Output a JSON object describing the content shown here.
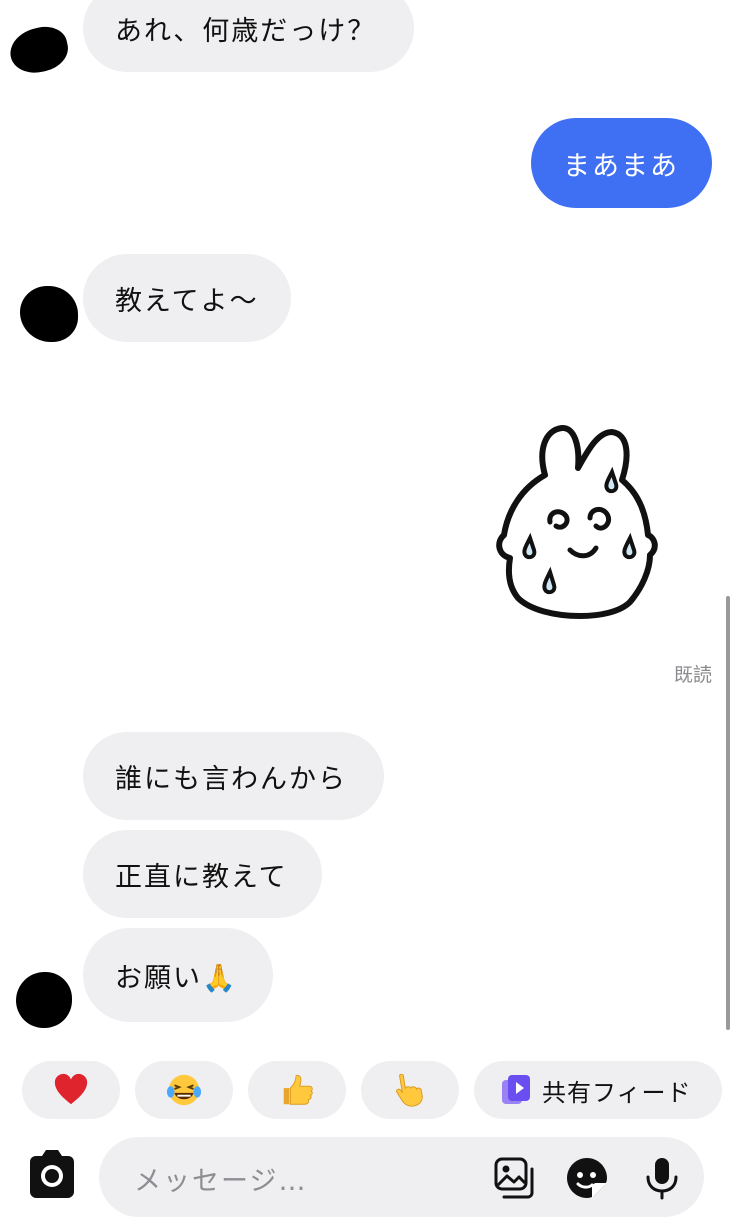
{
  "messages": [
    {
      "side": "incoming",
      "text": "あれ、何歳だっけ？"
    },
    {
      "side": "outgoing",
      "text": "まあまあ"
    },
    {
      "side": "incoming",
      "text": "教えてよ〜"
    },
    {
      "side": "outgoing",
      "type": "sticker",
      "sticker": "sweating-rabbit-sticker"
    },
    {
      "side": "incoming",
      "text": "誰にも言わんから"
    },
    {
      "side": "incoming",
      "text": "正直に教えて"
    },
    {
      "side": "incoming",
      "text": "お願い🙏"
    }
  ],
  "read_receipt": "既読",
  "quick_reactions": [
    {
      "icon": "heart-icon"
    },
    {
      "icon": "laughing-tears-icon"
    },
    {
      "icon": "thumbs-up-icon"
    },
    {
      "icon": "pointing-hand-icon"
    }
  ],
  "feed_chip": {
    "icon": "shared-feed-icon",
    "label": "共有フィード"
  },
  "composer": {
    "placeholder": "メッセージ…"
  },
  "colors": {
    "outgoing_bubble": "#3f6ff3",
    "incoming_bubble": "#efeff1",
    "background": "#ffffff"
  }
}
